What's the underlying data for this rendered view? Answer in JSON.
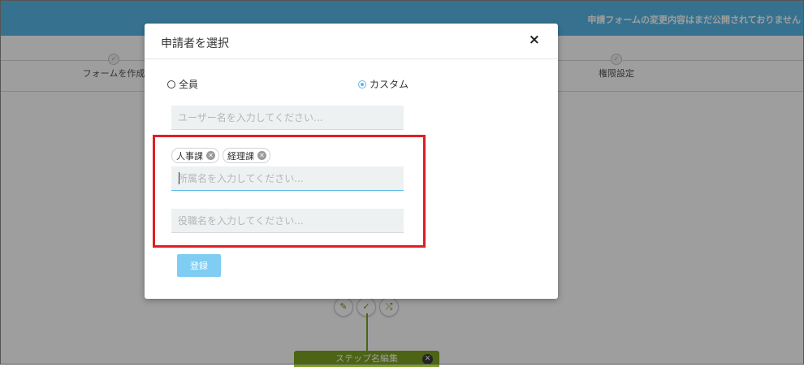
{
  "banner": {
    "text": "申請フォームの変更内容はまだ公開されておりません"
  },
  "steps": [
    {
      "label": "フォームを作成"
    },
    {
      "label": "権限設定"
    }
  ],
  "flow": {
    "node_label": "ステップ名編集"
  },
  "modal": {
    "title": "申請者を選択",
    "close_label": "×",
    "radio_all": "全員",
    "radio_custom": "カスタム",
    "radio_selected": "custom",
    "user_input": {
      "placeholder": "ユーザー名を入力してください...",
      "value": ""
    },
    "dept_tags": [
      "人事課",
      "経理課"
    ],
    "dept_input": {
      "placeholder": "所属名を入力してください...",
      "value": ""
    },
    "role_input": {
      "placeholder": "役職名を入力してください...",
      "value": ""
    },
    "submit_label": "登録"
  },
  "colors": {
    "accent": "#58b9e8",
    "flow_green": "#7ba21f",
    "highlight": "#e01e22"
  }
}
